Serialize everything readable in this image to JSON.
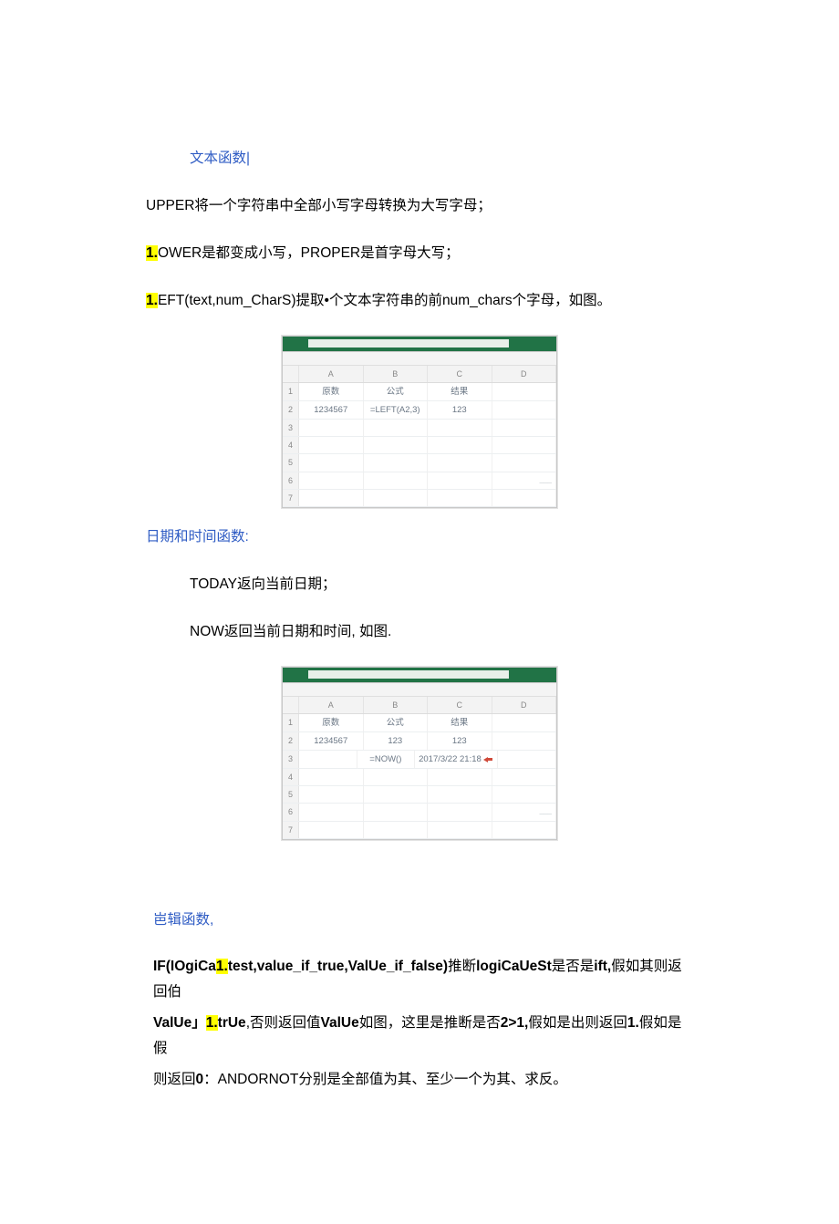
{
  "section1": {
    "heading": "文本函数|",
    "p1": "UPPER将一个字符串中全部小写字母转换为大写字母；",
    "p2_prefix": "1.",
    "p2_text": "OWER是都变成小写，PROPER是首字母大写；",
    "p3_prefix": "1.",
    "p3_text": "EFT(text,num_CharS)提取•个文本字符串的前num_chars个字母，如图。"
  },
  "sheet1": {
    "cols": [
      "A",
      "B",
      "C",
      "D"
    ],
    "rows": [
      {
        "n": "1",
        "cells": [
          "原数",
          "公式",
          "结果",
          ""
        ]
      },
      {
        "n": "2",
        "cells": [
          "1234567",
          "=LEFT(A2,3)",
          "123",
          ""
        ]
      },
      {
        "n": "3",
        "cells": [
          "",
          "",
          "",
          ""
        ]
      },
      {
        "n": "4",
        "cells": [
          "",
          "",
          "",
          ""
        ]
      },
      {
        "n": "5",
        "cells": [
          "",
          "",
          "",
          ""
        ]
      },
      {
        "n": "6",
        "cells": [
          "",
          "",
          "",
          ""
        ]
      },
      {
        "n": "7",
        "cells": [
          "",
          "",
          "",
          ""
        ]
      }
    ]
  },
  "section2": {
    "heading": "日期和时间函数:",
    "p1": "TODAY返向当前日期；",
    "p2": "NOW返回当前日期和时间, 如图."
  },
  "sheet2": {
    "cols": [
      "A",
      "B",
      "C",
      "D"
    ],
    "rows": [
      {
        "n": "1",
        "cells": [
          "原数",
          "公式",
          "结果",
          ""
        ]
      },
      {
        "n": "2",
        "cells": [
          "1234567",
          "123",
          "123",
          ""
        ]
      },
      {
        "n": "3",
        "cells": [
          "",
          "=NOW()",
          "2017/3/22 21:18",
          ""
        ]
      },
      {
        "n": "4",
        "cells": [
          "",
          "",
          "",
          ""
        ]
      },
      {
        "n": "5",
        "cells": [
          "",
          "",
          "",
          ""
        ]
      },
      {
        "n": "6",
        "cells": [
          "",
          "",
          "",
          ""
        ]
      },
      {
        "n": "7",
        "cells": [
          "",
          "",
          "",
          ""
        ]
      }
    ]
  },
  "section3": {
    "heading": "岜辑函数,",
    "l1_a": "IF(IOgiCa",
    "l1_hl": "1.",
    "l1_b": "test,value_if_true,ValUe_if_false)",
    "l1_c": "推断",
    "l1_d": "logiCaUeSt",
    "l1_e": "是否是",
    "l1_f": "ift,",
    "l1_g": "假如其则返回伯",
    "l2_a": "ValUe」",
    "l2_hl": "1.",
    "l2_b": "trUe",
    "l2_c": ",否则返回值",
    "l2_d": "ValUe",
    "l2_e": "如图，这里是推断是否",
    "l2_f": "2>1,",
    "l2_g": "假如是出则返回",
    "l2_h": "1.",
    "l2_i": "假如是假",
    "l3_a": "则返回",
    "l3_b": "0",
    "l3_c": "：ANDORNOT分别是全部值为其、至少一个为其、求反。"
  }
}
